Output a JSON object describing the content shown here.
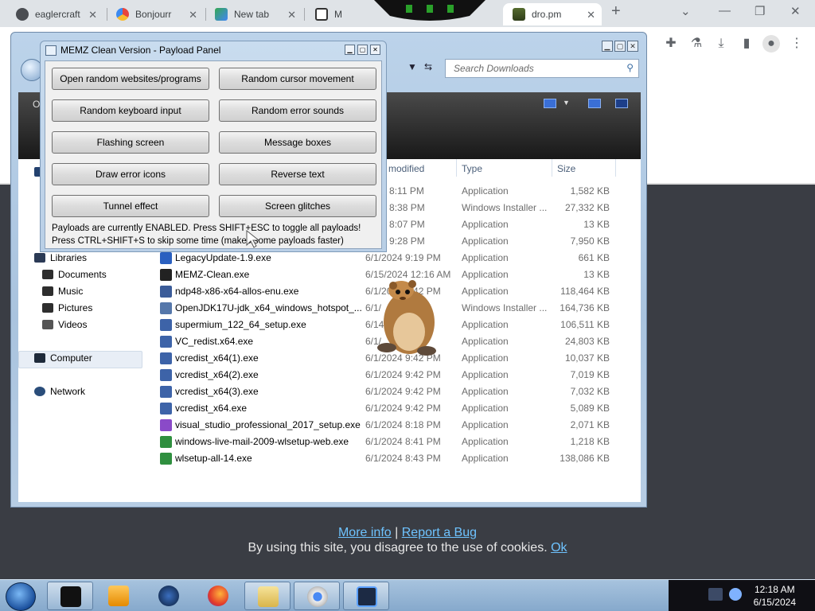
{
  "browser": {
    "tabs": [
      {
        "title": "eaglercraft",
        "active": false
      },
      {
        "title": "Bonjourr",
        "active": false
      },
      {
        "title": "New tab",
        "active": false
      },
      {
        "title": "M",
        "active": false
      },
      {
        "title": "dro.pm",
        "active": true
      }
    ],
    "new_tab_symbol": "+",
    "toolbar_icons": [
      "extensions-icon",
      "labs-icon",
      "download-icon",
      "side-panel-icon",
      "profile-icon",
      "kebab-menu-icon"
    ]
  },
  "page": {
    "more_info": "More info",
    "separator": "|",
    "report_bug": "Report a Bug",
    "cookie_text": "By using this site, you disagree to the use of cookies.",
    "ok": "Ok"
  },
  "explorer": {
    "search_placeholder": "Search Downloads",
    "banner_text": "O",
    "nav": {
      "libraries": "Libraries",
      "documents": "Documents",
      "music": "Music",
      "pictures": "Pictures",
      "videos": "Videos",
      "computer": "Computer",
      "network": "Network"
    },
    "columns": {
      "modified": "modified",
      "type": "Type",
      "size": "Size"
    },
    "files": [
      {
        "name": "",
        "date": "2024 8:11 PM",
        "type": "Application",
        "size": "1,582 KB"
      },
      {
        "name": "",
        "date": "2024 8:38 PM",
        "type": "Windows Installer ...",
        "size": "27,332 KB"
      },
      {
        "name": "",
        "date": "2024 8:07 PM",
        "type": "Application",
        "size": "13 KB"
      },
      {
        "name": "",
        "date": "2024 9:28 PM",
        "type": "Application",
        "size": "7,950 KB"
      },
      {
        "name": "LegacyUpdate-1.9.exe",
        "date": "6/1/2024 9:19 PM",
        "type": "Application",
        "size": "661 KB"
      },
      {
        "name": "MEMZ-Clean.exe",
        "date": "6/15/2024 12:16 AM",
        "type": "Application",
        "size": "13 KB"
      },
      {
        "name": "ndp48-x86-x64-allos-enu.exe",
        "date": "6/1/2024 9:42 PM",
        "type": "Application",
        "size": "118,464 KB"
      },
      {
        "name": "OpenJDK17U-jdk_x64_windows_hotspot_...",
        "date": "6/1/",
        "type": "Windows Installer ...",
        "size": "164,736 KB"
      },
      {
        "name": "supermium_122_64_setup.exe",
        "date": "6/14/",
        "type": "Application",
        "size": "106,511 KB"
      },
      {
        "name": "VC_redist.x64.exe",
        "date": "6/1/",
        "type": "Application",
        "size": "24,803 KB"
      },
      {
        "name": "vcredist_x64(1).exe",
        "date": "6/1/2024 9:42 PM",
        "type": "Application",
        "size": "10,037 KB"
      },
      {
        "name": "vcredist_x64(2).exe",
        "date": "6/1/2024 9:42 PM",
        "type": "Application",
        "size": "7,019 KB"
      },
      {
        "name": "vcredist_x64(3).exe",
        "date": "6/1/2024 9:42 PM",
        "type": "Application",
        "size": "7,032 KB"
      },
      {
        "name": "vcredist_x64.exe",
        "date": "6/1/2024 9:42 PM",
        "type": "Application",
        "size": "5,089 KB"
      },
      {
        "name": "visual_studio_professional_2017_setup.exe",
        "date": "6/1/2024 8:18 PM",
        "type": "Application",
        "size": "2,071 KB"
      },
      {
        "name": "windows-live-mail-2009-wlsetup-web.exe",
        "date": "6/1/2024 8:41 PM",
        "type": "Application",
        "size": "1,218 KB"
      },
      {
        "name": "wlsetup-all-14.exe",
        "date": "6/1/2024 8:43 PM",
        "type": "Application",
        "size": "138,086 KB"
      }
    ]
  },
  "memz": {
    "title": "MEMZ Clean Version - Payload Panel",
    "buttons": {
      "open_random": "Open random websites/programs",
      "cursor": "Random cursor movement",
      "keyboard": "Random keyboard input",
      "error_sounds": "Random error sounds",
      "flashing": "Flashing screen",
      "message_boxes": "Message boxes",
      "error_icons": "Draw error icons",
      "reverse_text": "Reverse text",
      "tunnel": "Tunnel effect",
      "glitches": "Screen glitches"
    },
    "status_line1": "Payloads are currently ENABLED. Press SHIFT+ESC to toggle all payloads!",
    "status_line2": "Press CTRL+SHIFT+S to skip some time (makes some payloads faster)"
  },
  "taskbar": {
    "time": "12:18 AM",
    "date": "6/15/2024"
  }
}
